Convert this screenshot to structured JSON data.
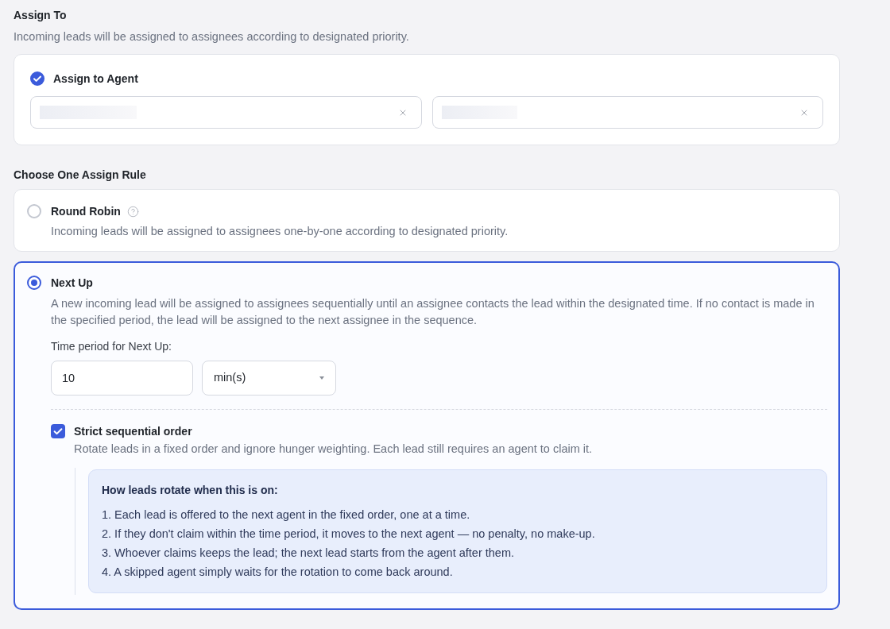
{
  "assign_to": {
    "title": "Assign To",
    "description": "Incoming leads will be assigned to assignees according to designated priority.",
    "agent": {
      "label": "Assign to Agent",
      "checked": true
    },
    "agent_fields": [
      {
        "blurred": true,
        "clearable": true
      },
      {
        "blurred": true,
        "clearable": true
      }
    ]
  },
  "assign_rule": {
    "title": "Choose One Assign Rule",
    "rules": [
      {
        "name": "Round Robin",
        "help": true,
        "selected": false,
        "description": "Incoming leads will be assigned to assignees one-by-one according to designated priority."
      },
      {
        "name": "Next Up",
        "help": false,
        "selected": true,
        "description": "A new incoming lead will be assigned to assignees sequentially until an assignee contacts the lead within the designated time. If no contact is made in the specified period, the lead will be assigned to the next assignee in the sequence.",
        "time_period": {
          "label": "Time period for Next Up:",
          "value": "10",
          "unit": "min(s)"
        },
        "strict_order": {
          "label": "Strict sequential order",
          "checked": true,
          "description": "Rotate leads in a fixed order and ignore hunger weighting. Each lead still requires an agent to claim it.",
          "info": {
            "title": "How leads rotate when this is on:",
            "steps": [
              "1. Each lead is offered to the next agent in the fixed order, one at a time.",
              "2. If they don't claim within the time period, it moves to the next agent — no penalty, no make-up.",
              "3. Whoever claims keeps the lead; the next lead starts from the agent after them.",
              "4. A skipped agent simply waits for the rotation to come back around."
            ]
          }
        }
      }
    ]
  }
}
